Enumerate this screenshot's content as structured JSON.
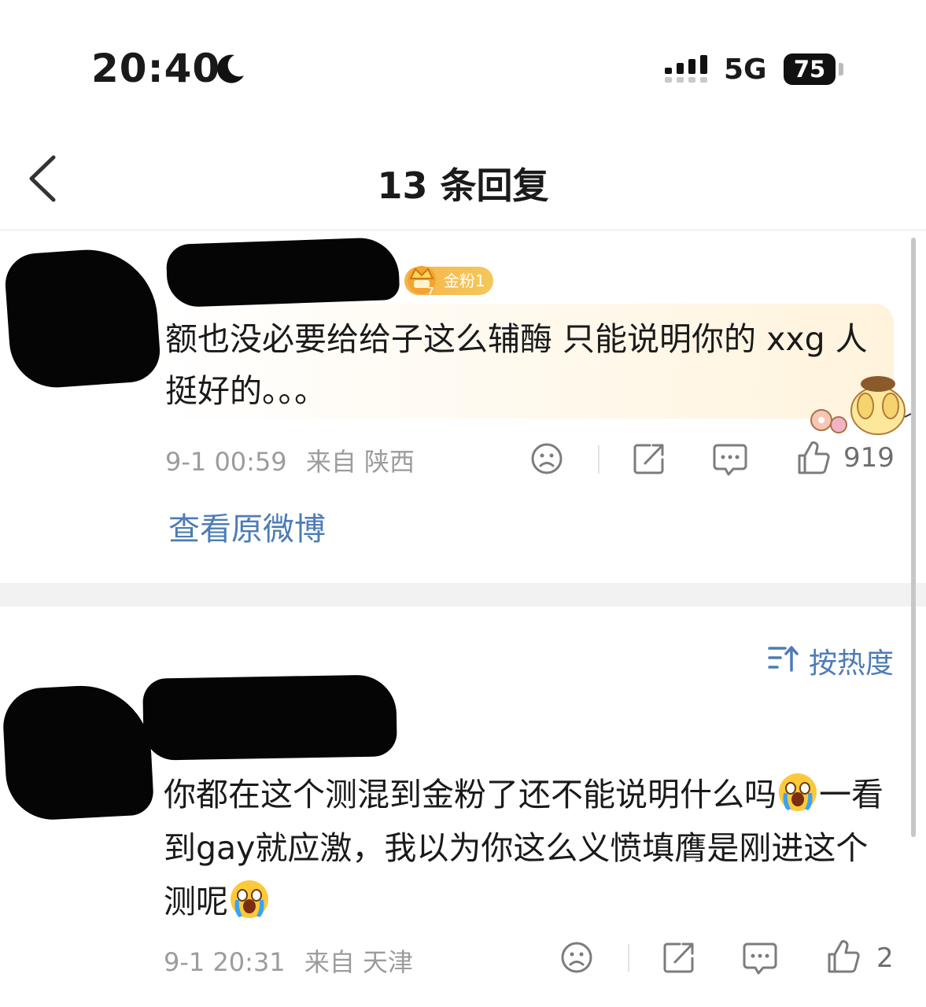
{
  "status_bar": {
    "time": "20:40",
    "network": "5G",
    "battery": "75"
  },
  "nav": {
    "title": "13 条回复"
  },
  "thread": {
    "root_comment": {
      "badge": "金粉1",
      "text": "额也没必要给给子这么辅酶 只能说明你的 xxg 人挺好的。。。",
      "time": "9-1 00:59",
      "location": "来自 陕西",
      "likes": "919"
    },
    "view_original_label": "查看原微博"
  },
  "sort": {
    "label": "按热度"
  },
  "replies": [
    {
      "text_part1": "你都在这个测混到金粉了还不能说明什么吗",
      "text_part2": "一看到gay就应激，我以为你这么义愤填膺是刚进这个测呢",
      "time": "9-1 20:31",
      "location": "来自 天津",
      "likes": "2"
    }
  ],
  "icons": [
    "moon-icon",
    "signal-icon",
    "back-icon",
    "crown-icon",
    "dislike-icon",
    "share-icon",
    "comment-icon",
    "like-icon",
    "sort-icon",
    "crying-emoji-icon"
  ]
}
